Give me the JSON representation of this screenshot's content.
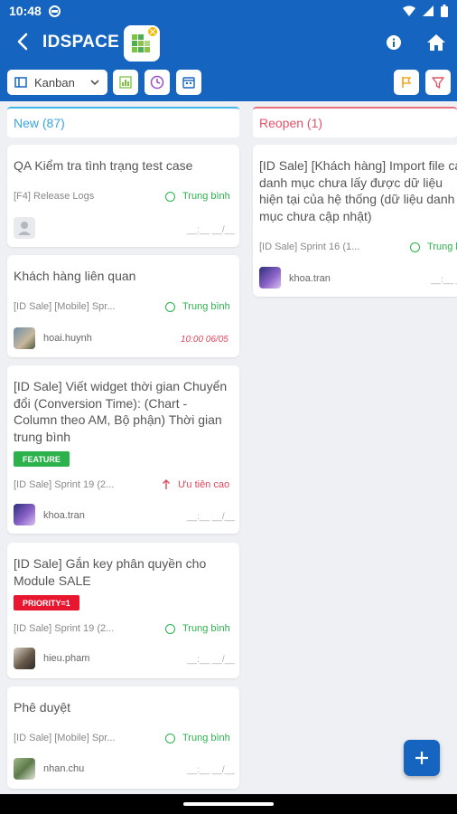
{
  "status_bar": {
    "time": "10:48"
  },
  "app_bar": {
    "title": "IDSPACE"
  },
  "toolbar": {
    "view_label": "Kanban"
  },
  "colors": {
    "primary": "#1565c0",
    "new_column": "#3aa5dd",
    "reopen_column": "#e05366",
    "normal_priority": "#2bb24c",
    "high_priority": "#e0475a",
    "feature_tag": "#2bb24c",
    "priority_tag": "#e8162f"
  },
  "columns": [
    {
      "title": "New (87)",
      "cards": [
        {
          "title": "QA Kiểm tra tình trạng test case",
          "project": "[F4] Release Logs",
          "priority": "Trung bình",
          "user": "",
          "date": "__:__ __/__",
          "avatar_icon": "default-avatar-icon"
        },
        {
          "title": "Khách hàng liên quan",
          "project": "[ID Sale] [Mobile] Spr...",
          "priority": "Trung bình",
          "user": "hoai.huynh",
          "date": "10:00 06/05"
        },
        {
          "title": "[ID Sale] Viết widget thời gian Chuyển đổi (Conversion Time): (Chart - Column theo AM, Bộ phận) Thời gian trung bình",
          "tag": "FEATURE",
          "project": "[ID Sale] Sprint 19 (2...",
          "priority": "Ưu tiên cao",
          "user": "khoa.tran",
          "date": "__:__ __/__"
        },
        {
          "title": "[ID Sale] Gắn key phân quyền cho Module SALE",
          "tag": "PRIORITY=1",
          "project": "[ID Sale] Sprint 19 (2...",
          "priority": "Trung bình",
          "user": "hieu.pham",
          "date": "__:__ __/__"
        },
        {
          "title": "Phê duyệt",
          "project": "[ID Sale] [Mobile] Spr...",
          "priority": "Trung bình",
          "user": "nhan.chu",
          "date": "__:__ __/__"
        }
      ]
    },
    {
      "title": "Reopen (1)",
      "cards": [
        {
          "title": "[ID Sale] [Khách hàng] Import file các danh mục chưa lấy được dữ liệu hiện tại của hệ thống (dữ liệu danh mục chưa cập nhật)",
          "project": "[ID Sale] Sprint 16 (1...",
          "priority": "Trung bình",
          "user": "khoa.tran",
          "date": "__:__ __/__"
        }
      ]
    }
  ]
}
